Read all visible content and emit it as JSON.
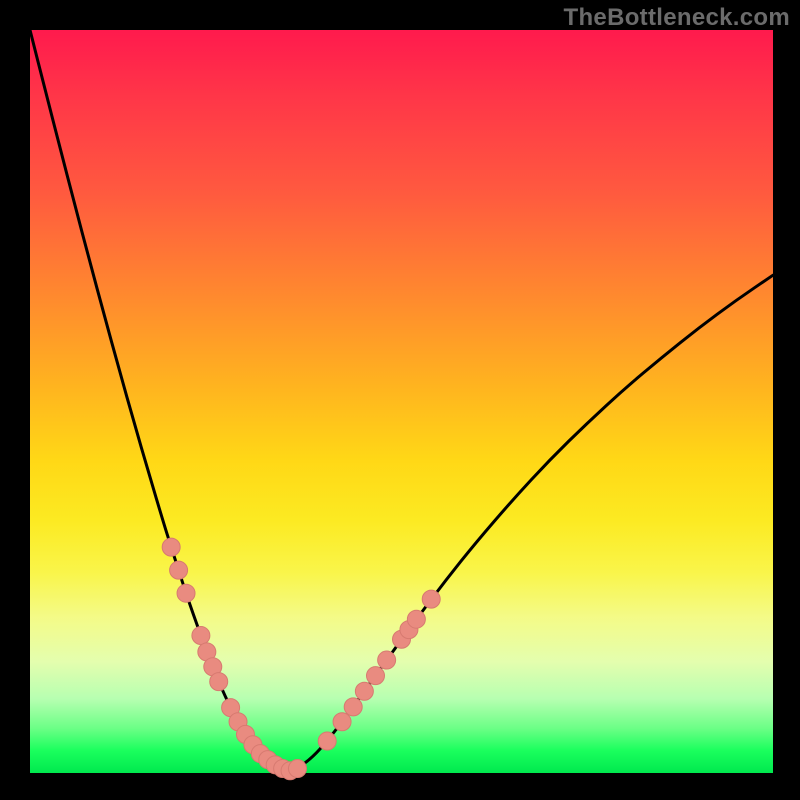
{
  "watermark": {
    "text": "TheBottleneck.com"
  },
  "colors": {
    "curve_stroke": "#000000",
    "marker_fill": "#e98b80",
    "marker_stroke": "#d77a70",
    "frame": "#000000"
  },
  "chart_data": {
    "type": "line",
    "title": "",
    "xlabel": "",
    "ylabel": "",
    "xlim": [
      0,
      100
    ],
    "ylim": [
      0,
      100
    ],
    "grid": false,
    "series": [
      {
        "name": "bottleneck-curve",
        "x": [
          0,
          2,
          4,
          6,
          8,
          10,
          12,
          14,
          16,
          18,
          19,
          20,
          21,
          22,
          23,
          23.8,
          24.6,
          25.4,
          26.2,
          27,
          27.5,
          28,
          28.5,
          29,
          29.5,
          30,
          30.5,
          31,
          32,
          33,
          34,
          35,
          36,
          38,
          40,
          42,
          45,
          48,
          52,
          56,
          60,
          65,
          70,
          75,
          80,
          85,
          90,
          95,
          100
        ],
        "values": [
          100,
          92.1,
          84.3,
          76.6,
          69.0,
          61.6,
          54.3,
          47.2,
          40.3,
          33.6,
          30.4,
          27.3,
          24.2,
          21.3,
          18.5,
          16.3,
          14.3,
          12.3,
          10.5,
          8.8,
          7.8,
          6.9,
          6.0,
          5.2,
          4.4,
          3.8,
          3.2,
          2.6,
          1.8,
          1.1,
          0.6,
          0.3,
          0.6,
          2.1,
          4.3,
          6.9,
          11.0,
          15.2,
          20.7,
          26.0,
          31.0,
          36.8,
          42.2,
          47.1,
          51.7,
          55.9,
          59.9,
          63.6,
          67.0
        ]
      }
    ],
    "markers": {
      "name": "highlighted-points",
      "points": [
        {
          "x": 19.0,
          "y": 30.4
        },
        {
          "x": 20.0,
          "y": 27.3
        },
        {
          "x": 21.0,
          "y": 24.2
        },
        {
          "x": 23.0,
          "y": 18.5
        },
        {
          "x": 23.8,
          "y": 16.3
        },
        {
          "x": 24.6,
          "y": 14.3
        },
        {
          "x": 25.4,
          "y": 12.3
        },
        {
          "x": 27.0,
          "y": 8.8
        },
        {
          "x": 28.0,
          "y": 6.9
        },
        {
          "x": 29.0,
          "y": 5.2
        },
        {
          "x": 30.0,
          "y": 3.8
        },
        {
          "x": 31.0,
          "y": 2.6
        },
        {
          "x": 32.0,
          "y": 1.8
        },
        {
          "x": 33.0,
          "y": 1.1
        },
        {
          "x": 34.0,
          "y": 0.6
        },
        {
          "x": 35.0,
          "y": 0.3
        },
        {
          "x": 36.0,
          "y": 0.6
        },
        {
          "x": 40.0,
          "y": 4.3
        },
        {
          "x": 42.0,
          "y": 6.9
        },
        {
          "x": 43.5,
          "y": 8.9
        },
        {
          "x": 45.0,
          "y": 11.0
        },
        {
          "x": 46.5,
          "y": 13.1
        },
        {
          "x": 48.0,
          "y": 15.2
        },
        {
          "x": 50.0,
          "y": 18.0
        },
        {
          "x": 51.0,
          "y": 19.3
        },
        {
          "x": 52.0,
          "y": 20.7
        },
        {
          "x": 54.0,
          "y": 23.4
        }
      ]
    }
  }
}
